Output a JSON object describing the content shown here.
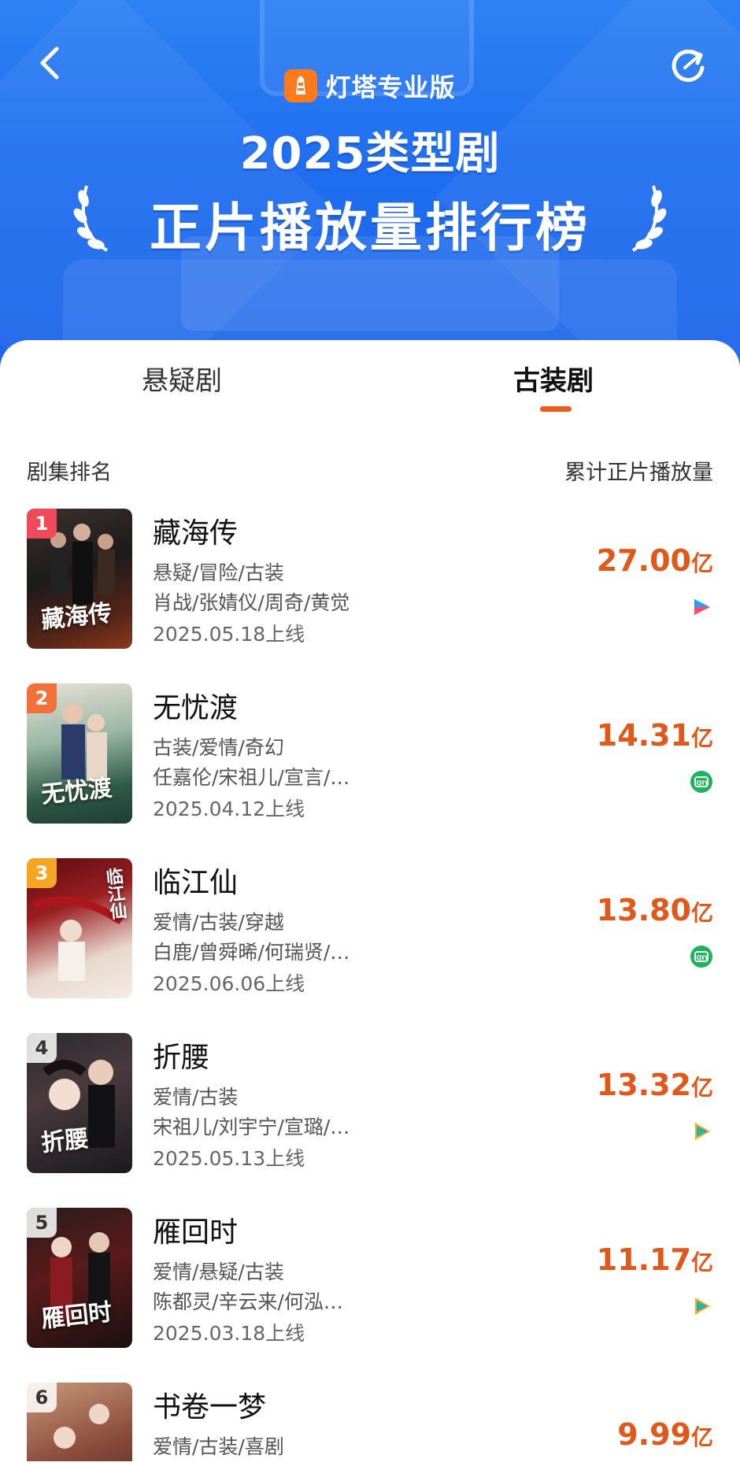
{
  "header": {
    "brand_name": "灯塔专业版",
    "title_line1": "2025类型剧",
    "title_line2": "正片播放量排行榜"
  },
  "tabs": [
    {
      "label": "悬疑剧",
      "active": false
    },
    {
      "label": "古装剧",
      "active": true
    }
  ],
  "columns": {
    "left": "剧集排名",
    "right": "累计正片播放量"
  },
  "colors": {
    "header_blue": "#1f6ef0",
    "accent_orange": "#e0581a",
    "rank1": "#f04a5a",
    "rank2": "#f0723a",
    "rank3": "#f5a623"
  },
  "dramas": [
    {
      "rank": "1",
      "title": "藏海传",
      "genres": "悬疑/冒险/古装",
      "cast": "肖战/张婧仪/周奇/黄觉",
      "release": "2025.05.18上线",
      "plays": "27.00",
      "unit": "亿",
      "platform_icon": "youku-icon"
    },
    {
      "rank": "2",
      "title": "无忧渡",
      "genres": "古装/爱情/奇幻",
      "cast": "任嘉伦/宋祖儿/宣言/…",
      "release": "2025.04.12上线",
      "plays": "14.31",
      "unit": "亿",
      "platform_icon": "iqiyi-icon"
    },
    {
      "rank": "3",
      "title": "临江仙",
      "genres": "爱情/古装/穿越",
      "cast": "白鹿/曾舜晞/何瑞贤/…",
      "release": "2025.06.06上线",
      "plays": "13.80",
      "unit": "亿",
      "platform_icon": "iqiyi-icon"
    },
    {
      "rank": "4",
      "title": "折腰",
      "genres": "爱情/古装",
      "cast": "宋祖儿/刘宇宁/宣璐/…",
      "release": "2025.05.13上线",
      "plays": "13.32",
      "unit": "亿",
      "platform_icon": "tencent-video-icon"
    },
    {
      "rank": "5",
      "title": "雁回时",
      "genres": "爱情/悬疑/古装",
      "cast": "陈都灵/辛云来/何泓…",
      "release": "2025.03.18上线",
      "plays": "11.17",
      "unit": "亿",
      "platform_icon": "tencent-video-icon"
    },
    {
      "rank": "6",
      "title": "书卷一梦",
      "genres": "爱情/古装/喜剧",
      "cast": "",
      "release": "",
      "plays": "9.99",
      "unit": "亿",
      "platform_icon": ""
    }
  ],
  "posters": [
    "藏海传",
    "无忧渡",
    "临江仙",
    "折腰",
    "雁回时",
    ""
  ]
}
